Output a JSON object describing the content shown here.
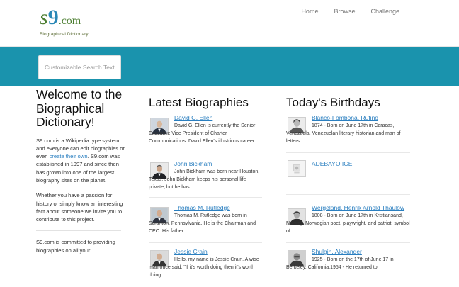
{
  "header": {
    "logo_s": "s",
    "logo_nine": "9",
    "logo_com": ".com",
    "logo_sub": "Biographical Dictionary",
    "nav": [
      "Home",
      "Browse",
      "Challenge"
    ]
  },
  "search": {
    "placeholder": "Customizable Search Text..."
  },
  "welcome": {
    "title": "Welcome to the Biographical Dictionary!",
    "p1_before": "S9.com is a Wikipedia type system and everyone can edit biographies or even ",
    "p1_link": "create their own",
    "p1_after": ". S9.com was established in 1997 and since then has grown into one of the largest biography sites on the planet.",
    "p2": "Whether you have a passion for history or simply know an interesting fact about someone we invite you to contribute to this project.",
    "p3": "S9.com is committed to providing biographies on all your"
  },
  "latest": {
    "title": "Latest Biographies",
    "items": [
      {
        "name": "David G. Ellen",
        "text": "David G. Ellen is currently the Senior Executive Vice President of Charter Communications. David Ellen's illustrious career"
      },
      {
        "name": "John Bickham",
        "text": "John Bickham was born near Houston, Texas. John Bickham keeps his personal life private, but he has"
      },
      {
        "name": "Thomas M. Rutledge",
        "text": "Thomas M. Rutledge was born in Scranton, Pennsylvania. He is the Chairman and CEO. His father"
      },
      {
        "name": "Jessie Crain",
        "text": "Hello, my name is Jessie Crain. A wise man once said, \"If it's worth doing then it's worth doing"
      }
    ]
  },
  "birthdays": {
    "title": "Today's Birthdays",
    "items": [
      {
        "name": "Blanco-Fombona, Rufino",
        "text": "1874 - Born on June 17th in Caracas, Venezuela. Venezuelan literary historian and man of letters"
      },
      {
        "name": "ADEBAYO IGE",
        "text": ""
      },
      {
        "name": "Wergeland, Henrik Arnold Thaulow",
        "text": "1808 - Born on June 17th in Kristiansand, Norway. Norwegian poet, playwright, and patriot, symbol of"
      },
      {
        "name": "Shulgin, Alexander",
        "text": "1925 - Born on the 17th of June 17 in Berkeley, California.1954 - He returned to"
      }
    ]
  },
  "colors": {
    "banner": "#1a93ad",
    "link": "#2a7fc0",
    "logo_green": "#4a7d2f",
    "logo_blue": "#2a88b6"
  },
  "icons": [
    "portrait-photo",
    "placeholder-photo"
  ]
}
